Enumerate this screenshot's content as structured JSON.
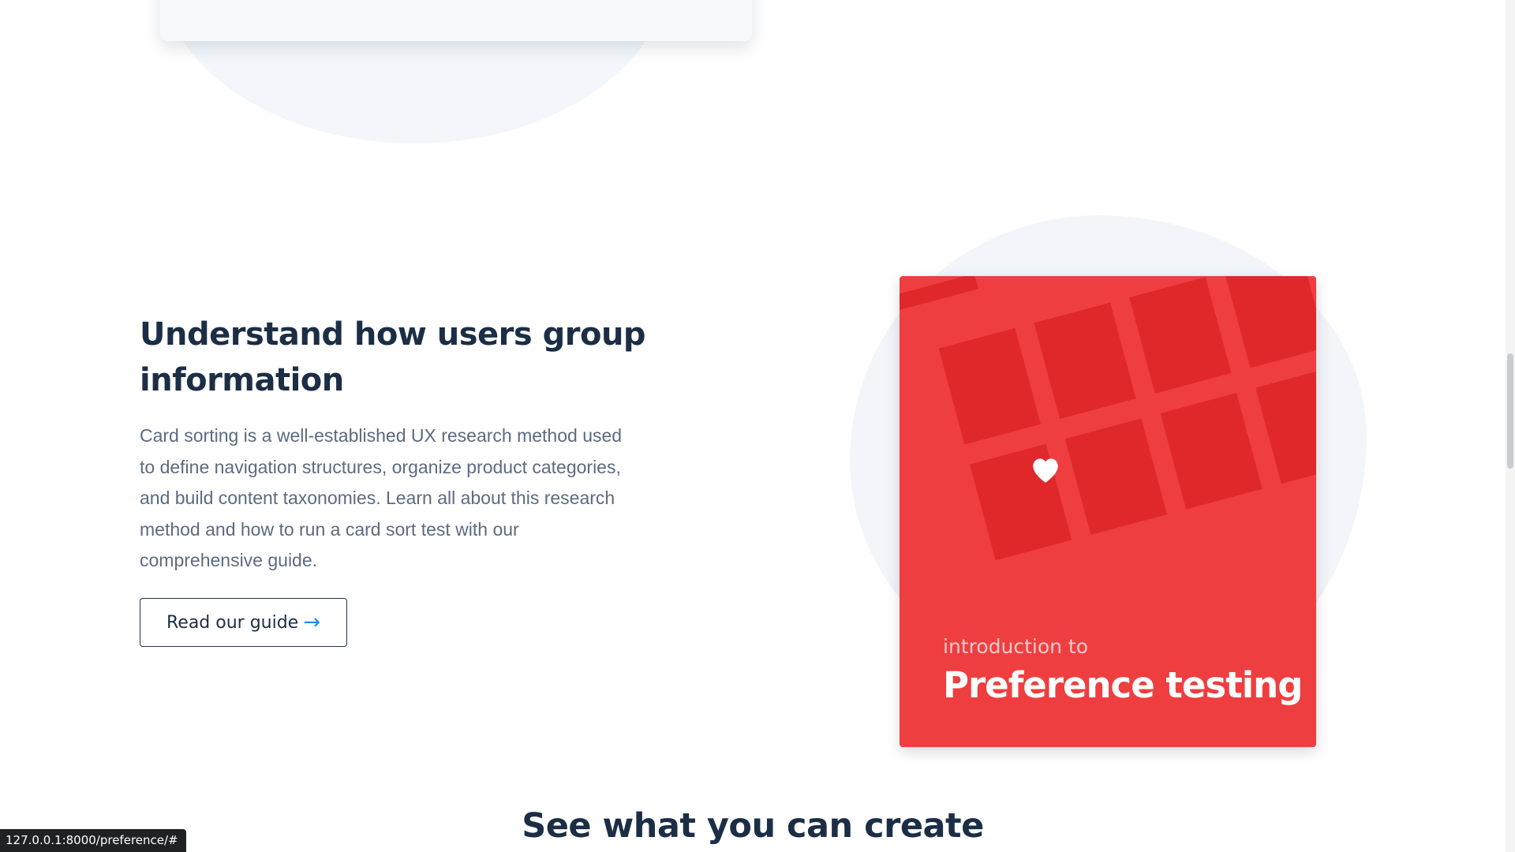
{
  "guide_section": {
    "headline": "Understand how users group information",
    "body": "Card sorting is a well-established UX research method used to define navigation structures, organize product categories, and build content taxonomies. Learn all about this research method and how to run a card sort test with our comprehensive guide.",
    "button_label": "Read our guide",
    "button_icon": "arrow-right-icon"
  },
  "promo_card": {
    "kicker": "introduction to",
    "title": "Preference testing",
    "icon": "heart-icon",
    "colors": {
      "background": "#ef3e40",
      "tile": "#e0282b",
      "kicker": "#f7c9cb"
    }
  },
  "next_section": {
    "title": "See what you can create"
  },
  "status_bar": {
    "url": "127.0.0.1:8000/preference/#"
  },
  "colors": {
    "heading": "#1b2e45",
    "body_text": "#5b6b80",
    "accent": "#1e8be6",
    "blob": "#f3f7fb"
  }
}
